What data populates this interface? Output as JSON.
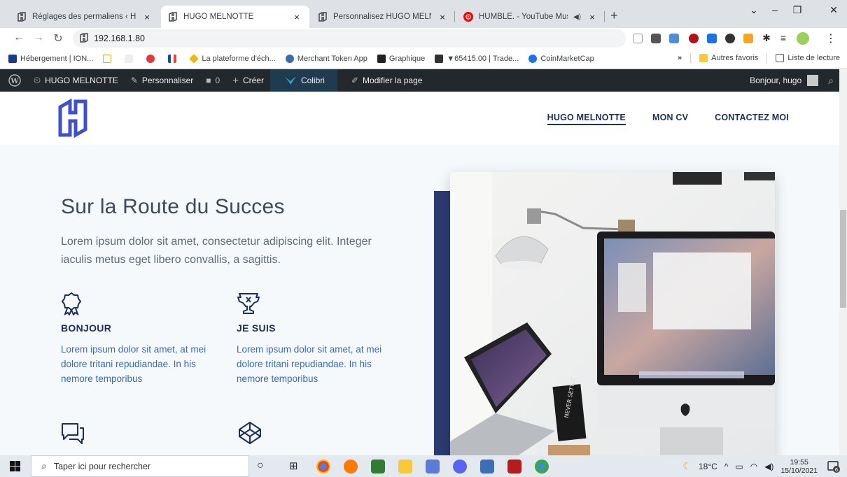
{
  "browser": {
    "tabs": [
      {
        "title": "Réglages des permaliens ‹ HUGO MELNOTTE",
        "close": "×"
      },
      {
        "title": "HUGO MELNOTTE",
        "close": "×"
      },
      {
        "title": "Personnalisez HUGO MELNOTTE",
        "close": "×"
      },
      {
        "title": "HUMBLE. - YouTube Music",
        "close": "×"
      }
    ],
    "new_tab": "+",
    "address": "192.168.1.80",
    "bookmarks": [
      "Hébergement | ION...",
      "",
      "",
      "",
      "",
      "La plateforme d'éch...",
      "Merchant Token App",
      "Graphique",
      "▼65415.00 | Trade...",
      "CoinMarketCap"
    ],
    "bookmarks_overflow": "»",
    "other_bookmarks": "Autres favoris",
    "reading_list": "Liste de lecture"
  },
  "wp_admin_bar": {
    "site_name": "HUGO MELNOTTE",
    "customize": "Personnaliser",
    "comments_count": "0",
    "new": "Créer",
    "colibri": "Colibri",
    "edit_page": "Modifier la page",
    "greeting": "Bonjour, hugo"
  },
  "site": {
    "nav": [
      "HUGO MELNOTTE",
      "MON CV",
      "CONTACTEZ MOI"
    ],
    "hero": {
      "title": "Sur la Route du Succes",
      "subtitle": "Lorem ipsum dolor sit amet, consectetur adipiscing elit. Integer iaculis metus eget libero convallis, a sagittis."
    },
    "features": [
      {
        "title": "BONJOUR",
        "text": "Lorem ipsum dolor sit amet, at mei dolore tritani repudiandae. In his nemore temporibus",
        "icon": "award-icon"
      },
      {
        "title": "JE SUIS",
        "text": "Lorem ipsum dolor sit amet, at mei dolore tritani repudiandae. In his nemore temporibus",
        "icon": "trophy-icon"
      },
      {
        "title": "",
        "text": "",
        "icon": "chat-icon"
      },
      {
        "title": "",
        "text": "",
        "icon": "codepen-icon"
      }
    ],
    "photo_sign": "NEVER SETTLE"
  },
  "taskbar": {
    "search_placeholder": "Taper ici pour rechercher",
    "temperature": "18°C",
    "time": "19:55",
    "date": "15/10/2021",
    "notification_count": "6"
  },
  "colors": {
    "brand_navy": "#1c2e5b",
    "accent_blue": "#3a6ab0",
    "logo_blue": "#3f51c9",
    "admin_bar": "#23282d"
  }
}
